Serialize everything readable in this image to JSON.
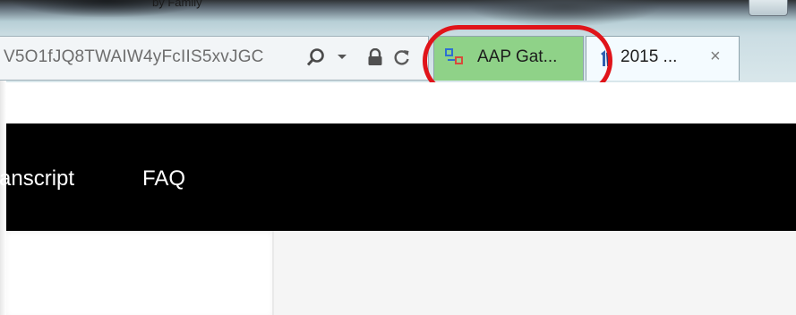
{
  "window": {
    "title_fragment": "by Family"
  },
  "addressbar": {
    "url": "V5O1fJQ8TWAIW4yFcIIS5xvJGC",
    "icons": [
      "search-icon",
      "dropdown-arrow-icon",
      "lock-icon",
      "refresh-icon"
    ]
  },
  "tabs": [
    {
      "label": "AAP Gat...",
      "active": true,
      "favicon": "aap-favicon-icon"
    },
    {
      "label": "2015 ...",
      "active": false,
      "favicon": "2015-favicon-icon",
      "close": "×"
    }
  ],
  "annotation": {
    "color": "#e0141a"
  },
  "nav": {
    "items": [
      {
        "label": "anscript"
      },
      {
        "label": "FAQ"
      }
    ]
  },
  "colors": {
    "active_tab": "#8fd288",
    "navbar": "#000000",
    "right_panel": "#f5f5f5"
  }
}
